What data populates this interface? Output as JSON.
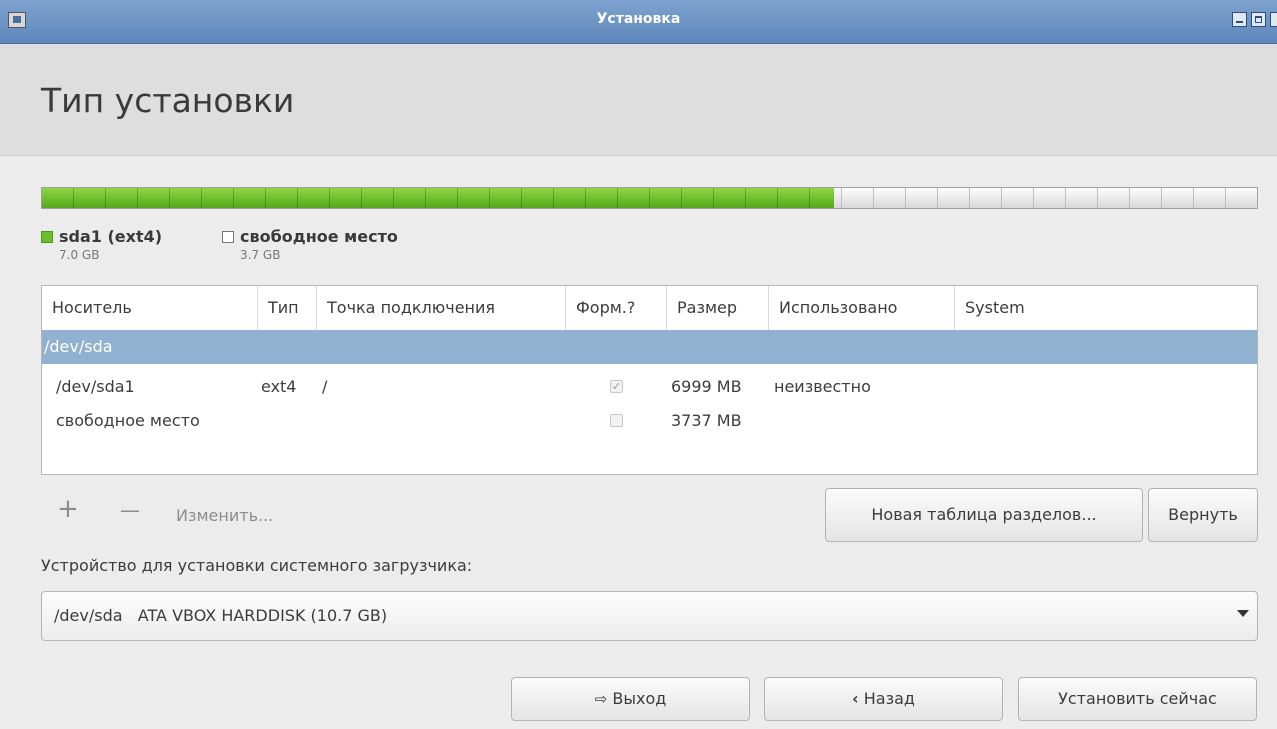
{
  "window": {
    "title": "Установка"
  },
  "header": {
    "title": "Тип установки"
  },
  "partition_bar": {
    "used_fraction": 0.652,
    "used_color": "#6cbf2b"
  },
  "legend": [
    {
      "label": "sda1 (ext4)",
      "size": "7.0 GB",
      "color": "#6cbf2b"
    },
    {
      "label": "свободное место",
      "size": "3.7 GB",
      "color": "#ffffff"
    }
  ],
  "table": {
    "columns": [
      "Носитель",
      "Тип",
      "Точка подключения",
      "Форм.?",
      "Размер",
      "Использовано",
      "System"
    ],
    "device_row": "/dev/sda",
    "rows": [
      {
        "device": "/dev/sda1",
        "type": "ext4",
        "mount": "/",
        "format": true,
        "size": "6999 MB",
        "used": "неизвестно",
        "system": ""
      },
      {
        "device": "свободное место",
        "type": "",
        "mount": "",
        "format": false,
        "size": "3737 MB",
        "used": "",
        "system": ""
      }
    ]
  },
  "tools": {
    "add": "+",
    "remove": "—",
    "change": "Изменить..."
  },
  "buttons": {
    "new_table": "Новая таблица разделов...",
    "revert": "Вернуть",
    "quit": "Выход",
    "back": "Назад",
    "install": "Установить сейчас"
  },
  "bootloader": {
    "label": "Устройство для установки системного загрузчика:",
    "value": "/dev/sda   ATA VBOX HARDDISK (10.7 GB)"
  }
}
